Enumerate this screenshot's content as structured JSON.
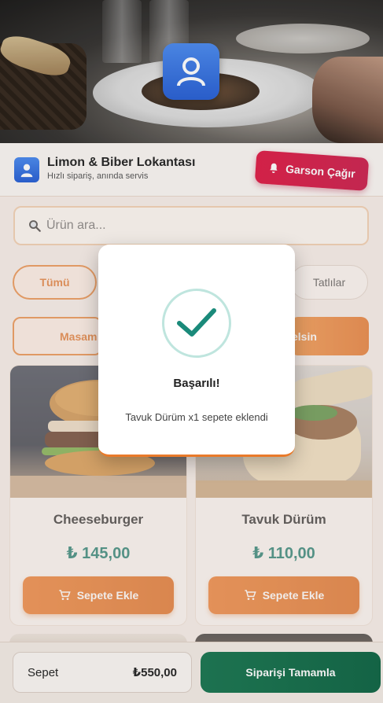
{
  "restaurant": {
    "name": "Limon & Biber Lokantası",
    "tagline": "Hızlı sipariş, anında servis"
  },
  "header": {
    "call_waiter_label": "Garson Çağır"
  },
  "search": {
    "placeholder": "Ürün ara..."
  },
  "categories": {
    "active": "Tümü",
    "visible_right": "Tatlılar"
  },
  "actions": {
    "table_label": "Masam",
    "waiter_label": "elsin"
  },
  "products": [
    {
      "name": "Cheeseburger",
      "price": "₺ 145,00",
      "button": "Sepete Ekle"
    },
    {
      "name": "Tavuk Dürüm",
      "price": "₺ 110,00",
      "button": "Sepete Ekle"
    }
  ],
  "cart": {
    "label": "Sepet",
    "total": "₺550,00"
  },
  "checkout": {
    "label": "Siparişi Tamamla"
  },
  "modal": {
    "title": "Başarılı!",
    "message": "Tavuk Dürüm x1 sepete eklendi"
  },
  "colors": {
    "accent": "#e8853a",
    "danger": "#d8254f",
    "success": "#1f7a55",
    "price": "#1a7a6b",
    "check": "#1a8a7a"
  }
}
